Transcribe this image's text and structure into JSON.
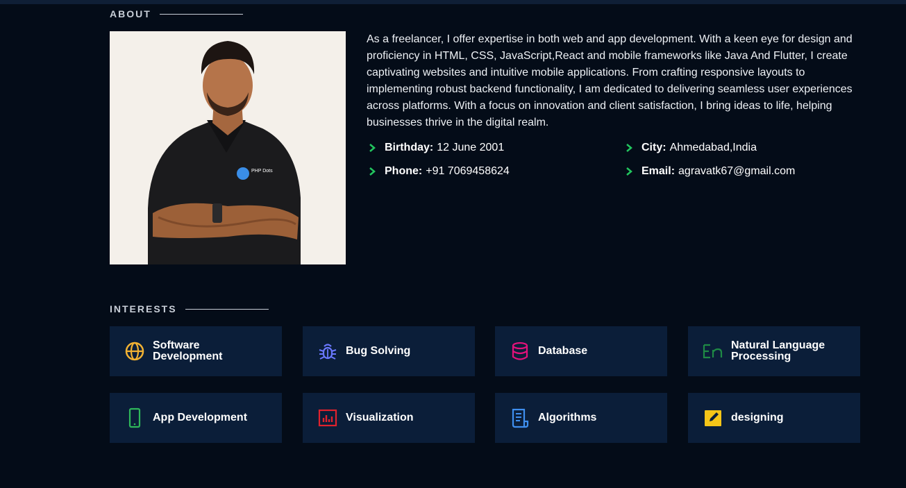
{
  "about": {
    "title": "ABOUT",
    "bio": "As a freelancer, I offer expertise in both web and app development. With a keen eye for design and proficiency in HTML, CSS, JavaScript,React and mobile frameworks like Java And Flutter, I create captivating websites and intuitive mobile applications. From crafting responsive layouts to implementing robust backend functionality, I am dedicated to delivering seamless user experiences across platforms. With a focus on innovation and client satisfaction, I bring ideas to life, helping businesses thrive in the digital realm.",
    "photo_logo_text": "PHP Dots",
    "facts": [
      {
        "label": "Birthday:",
        "value": "12 June 2001"
      },
      {
        "label": "City:",
        "value": "Ahmedabad,India"
      },
      {
        "label": "Phone:",
        "value": "+91 7069458624"
      },
      {
        "label": "Email:",
        "value": "agravatk67@gmail.com"
      }
    ],
    "accent_color": "#22c55e"
  },
  "interests": {
    "title": "INTERESTS",
    "items": [
      {
        "label": "Software Development",
        "icon": "globe-icon",
        "color": "#f2b233"
      },
      {
        "label": "Bug Solving",
        "icon": "bug-icon",
        "color": "#6a78ff"
      },
      {
        "label": "Database",
        "icon": "database-icon",
        "color": "#e3127b"
      },
      {
        "label": "Natural Language Processing",
        "icon": "language-icon",
        "color": "#1f8a45"
      },
      {
        "label": "App Development",
        "icon": "phone-icon",
        "color": "#2fb75a"
      },
      {
        "label": "Visualization",
        "icon": "bar-chart-icon",
        "color": "#e0222d"
      },
      {
        "label": "Algorithms",
        "icon": "document-icon",
        "color": "#3f8ff0"
      },
      {
        "label": "designing",
        "icon": "edit-icon",
        "color": "#f5c518"
      }
    ]
  }
}
